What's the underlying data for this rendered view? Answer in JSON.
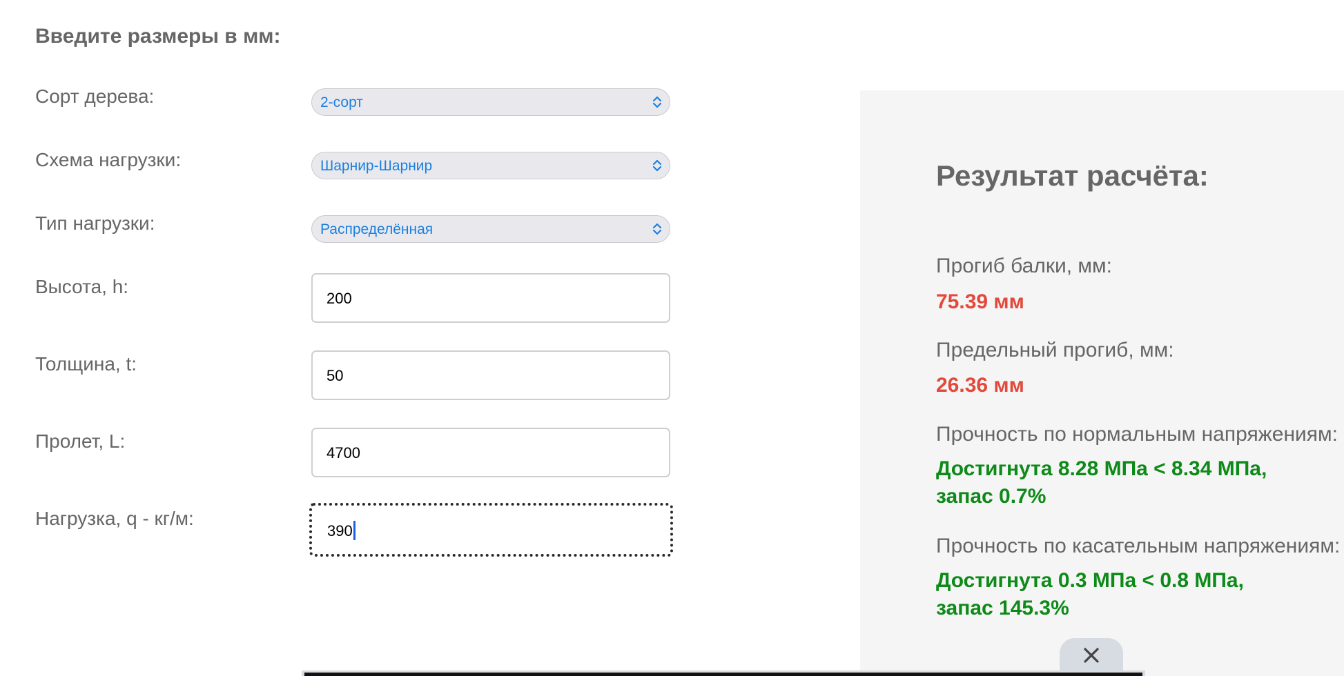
{
  "form": {
    "heading": "Введите размеры в мм:",
    "fields": [
      {
        "label": "Сорт дерева:",
        "value": "2-сорт"
      },
      {
        "label": "Схема нагрузки:",
        "value": "Шарнир-Шарнир"
      },
      {
        "label": "Тип нагрузки:",
        "value": "Распределённая"
      },
      {
        "label": "Высота, h:",
        "value": "200"
      },
      {
        "label": "Толщина, t:",
        "value": "50"
      },
      {
        "label": "Пролет, L:",
        "value": "4700"
      },
      {
        "label": "Нагрузка, q - кг/м:",
        "value": "390"
      }
    ]
  },
  "results": {
    "title": "Результат расчёта:",
    "deflection_label": "Прогиб балки, мм:",
    "deflection_value": "75.39 мм",
    "limit_label": "Предельный прогиб, мм:",
    "limit_value": "26.36 мм",
    "normal_label": "Прочность по нормальным напряжениям:",
    "normal_line1": "Достигнута 8.28 МПа < 8.34 МПа,",
    "normal_line2": "запас 0.7%",
    "shear_label": "Прочность по касательным напряжениям:",
    "shear_line1": "Достигнута 0.3 МПа < 0.8 МПа,",
    "shear_line2": "запас 145.3%"
  },
  "colors": {
    "accent": "#1a7fe0",
    "fail": "#e2493b",
    "pass": "#0d8a18",
    "panel_bg": "#f5f5f5"
  },
  "icons": {
    "select_arrows": "chevron-updown-icon",
    "close": "close-icon"
  }
}
